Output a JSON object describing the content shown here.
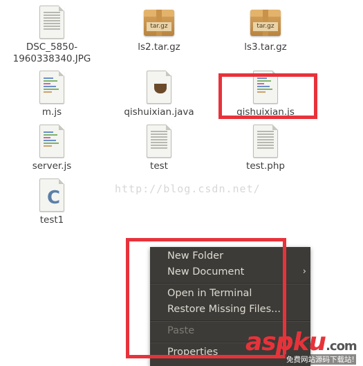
{
  "files": [
    {
      "name": "DSC_5850-\n1960338340.JPG",
      "type": "image"
    },
    {
      "name": "ls2.tar.gz",
      "type": "archive",
      "badge": "tar.gz"
    },
    {
      "name": "ls3.tar.gz",
      "type": "archive",
      "badge": "tar.gz"
    },
    {
      "name": "m.js",
      "type": "script"
    },
    {
      "name": "qishuixian.java",
      "type": "java"
    },
    {
      "name": "qishuixian.js",
      "type": "script"
    },
    {
      "name": "server.js",
      "type": "script"
    },
    {
      "name": "test",
      "type": "text"
    },
    {
      "name": "test.php",
      "type": "text"
    },
    {
      "name": "test1",
      "type": "c"
    }
  ],
  "watermark": "http://blog.csdn.net/",
  "context_menu": {
    "new_folder": "New Folder",
    "new_document": "New Document",
    "submenu_arrow": "›",
    "open_terminal": "Open in Terminal",
    "restore_missing": "Restore Missing Files...",
    "paste": "Paste",
    "properties": "Properties"
  },
  "brand": {
    "main": "aspku",
    "suffix": ".com",
    "sub": "免费网站源码下载站!"
  },
  "colors": {
    "highlight_box": "#e8323a",
    "menu_bg": "#3c3b37"
  }
}
